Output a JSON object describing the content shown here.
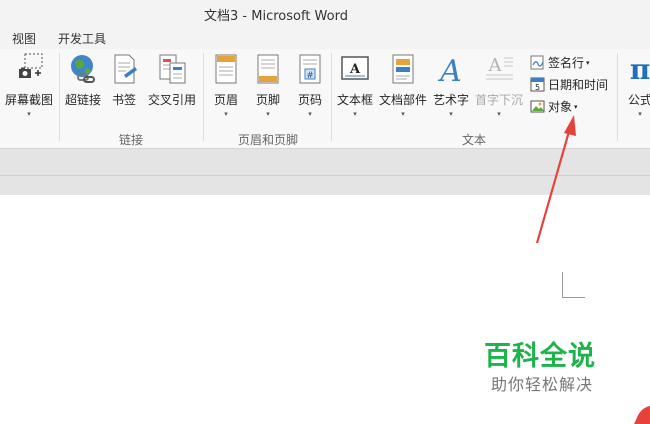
{
  "window": {
    "title": "文档3 - Microsoft Word"
  },
  "menu": {
    "view": "视图",
    "developer": "开发工具"
  },
  "ribbon": {
    "screenshot": "屏幕截图",
    "hyperlink": "超链接",
    "bookmark": "书签",
    "crossref": "交叉引用",
    "header": "页眉",
    "footer": "页脚",
    "pagenum": "页码",
    "textbox": "文本框",
    "quickparts": "文档部件",
    "wordart": "艺术字",
    "dropcap": "首字下沉",
    "signature": "签名行",
    "datetime": "日期和时间",
    "object": "对象",
    "equation": "公式",
    "caret": "▾",
    "groups": {
      "links": "链接",
      "headerfooter": "页眉和页脚",
      "text": "文本"
    }
  },
  "watermark": {
    "title": "百科全说",
    "subtitle": "助你轻松解决"
  },
  "colors": {
    "watermark_green": "#1db44c",
    "arrow_red": "#e8413a"
  }
}
